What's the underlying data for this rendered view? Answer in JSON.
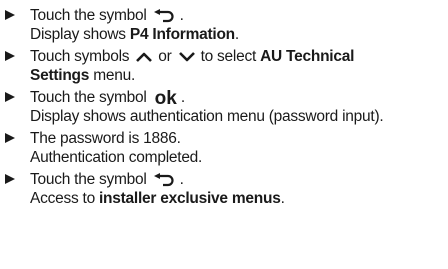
{
  "steps": [
    {
      "l1_pre": "Touch the symbol",
      "l1_post": ".",
      "l2_pre": "Display shows ",
      "l2_bold": "P4 Information",
      "l2_post": "."
    },
    {
      "l1_pre": "Touch symbols",
      "l1_mid": "or",
      "l1_post": "to select ",
      "l1_bold": "AU Technical",
      "l2_bold": "Settings",
      "l2_post": " menu."
    },
    {
      "l1_pre": "Touch the symbol",
      "l1_sym": "ok",
      "l1_post": ".",
      "l2": "Display shows authentication menu (password input)."
    },
    {
      "l1": "The password is 1886.",
      "l2": "Authentication completed."
    },
    {
      "l1_pre": "Touch the symbol",
      "l1_post": ".",
      "l2_pre": "Access to ",
      "l2_bold": "installer exclusive menus",
      "l2_post": "."
    }
  ],
  "icons": [
    "bullet-triangle-icon",
    "back-arrow-icon",
    "chevron-up-icon",
    "chevron-down-icon",
    "ok-symbol"
  ]
}
